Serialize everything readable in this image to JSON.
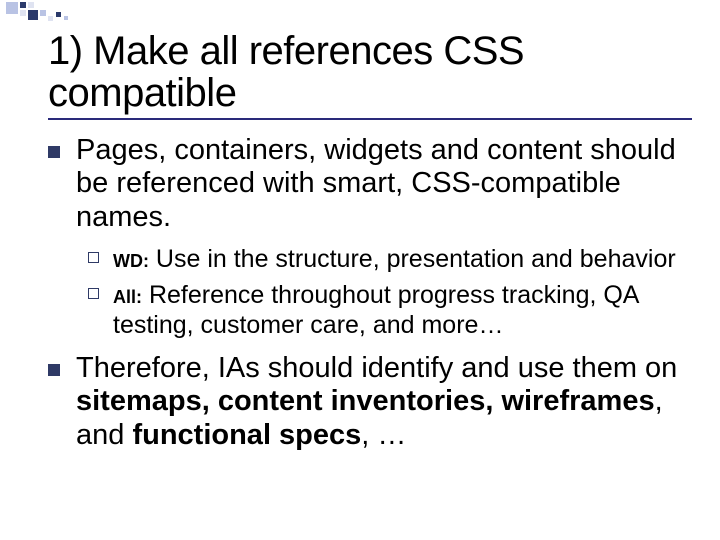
{
  "title": "1) Make all references CSS compatible",
  "bullets": [
    {
      "type": "l1",
      "text": "Pages, containers, widgets and content should be referenced with smart, CSS-compatible names."
    },
    {
      "type": "l2",
      "prefix": "WD:",
      "text": " Use in the structure, presentation and behavior"
    },
    {
      "type": "l2",
      "prefix": "All:",
      "text": " Reference throughout progress tracking, QA testing, customer care, and more…"
    },
    {
      "type": "l1",
      "pre": "Therefore, IAs should identify and use them on ",
      "bold": "sitemaps, content inventories, wireframes",
      "post": ", and ",
      "bold2": "functional specs",
      "post2": ", …"
    }
  ],
  "deco": {
    "colors": {
      "dark": "#2b3a6b",
      "light": "#b9c3e4",
      "pale": "#dfe3f1"
    }
  }
}
